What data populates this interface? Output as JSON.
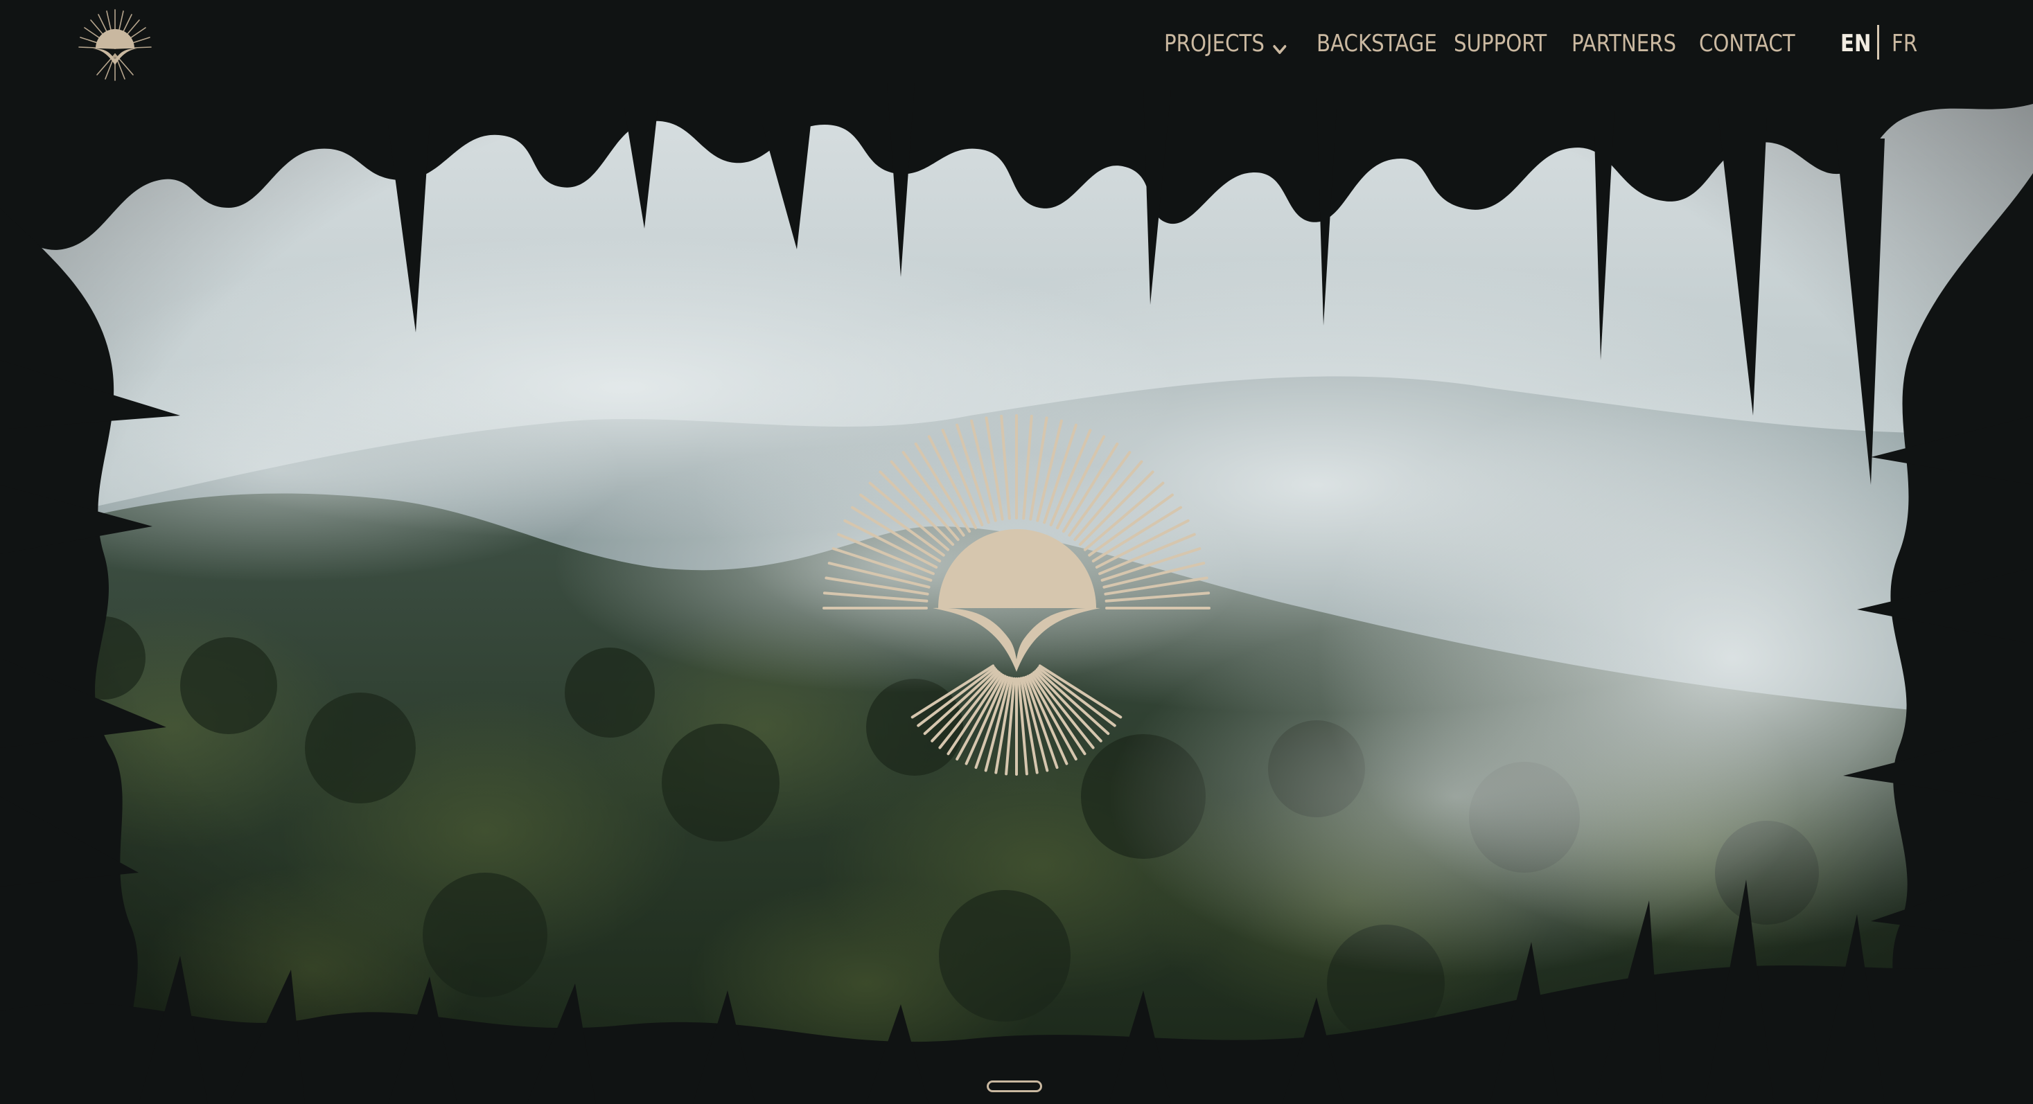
{
  "nav": {
    "items": [
      {
        "label": "PROJECTS",
        "has_dropdown": true
      },
      {
        "label": "BACKSTAGE"
      },
      {
        "label": "SUPPORT"
      },
      {
        "label": "PARTNERS"
      },
      {
        "label": "CONTACT"
      }
    ]
  },
  "language": {
    "options": [
      "EN",
      "FR"
    ],
    "active": "EN"
  },
  "icons": {
    "site_logo": "sunburst-bird-logo-icon",
    "dropdown": "chevron-down-icon",
    "hero_emblem": "sunburst-bird-emblem-icon",
    "scroll": "scroll-indicator-icon"
  },
  "colors": {
    "background": "#111414",
    "nav_text": "#cbb9a1",
    "active_lang": "#f2ece2",
    "emblem": "#d6c6ae"
  }
}
